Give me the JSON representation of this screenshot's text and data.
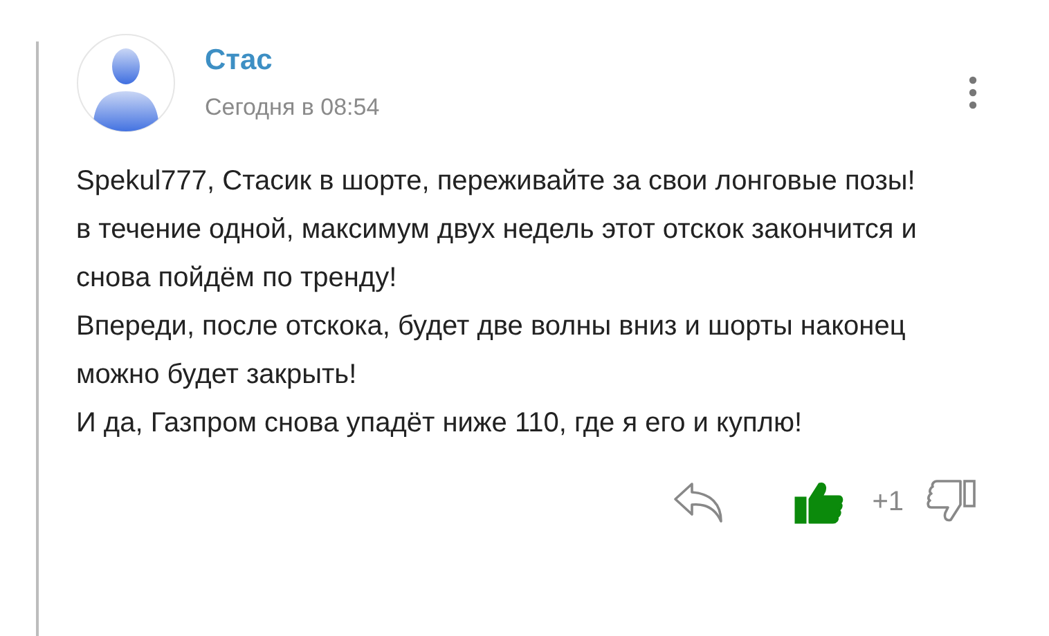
{
  "comment": {
    "author": "Стас",
    "time": "Сегодня в 08:54",
    "paragraphs": [
      "Spekul777, Стасик в шорте, переживайте за свои лонговые позы!",
      "в течение одной, максимум двух недель этот отскок закончится и снова пойдём по тренду!",
      "Впереди, после отскока, будет две волны вниз и шорты наконец можно будет закрыть!",
      "И да, Газпром снова упадёт ниже 110, где я его и куплю!"
    ],
    "liked": true,
    "score": "+1"
  }
}
